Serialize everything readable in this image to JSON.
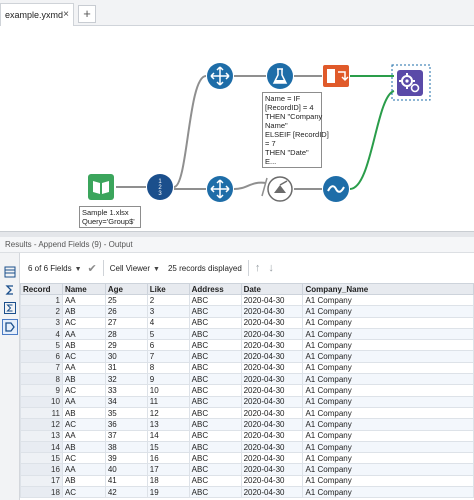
{
  "tabs": [
    {
      "label": "example.yxmd",
      "close": "×"
    }
  ],
  "tab_add": "+",
  "annotations": {
    "input": [
      "Sample 1.xlsx",
      "Query='Group$'"
    ],
    "formula": [
      "Name = IF",
      "[RecordID] = 4",
      "THEN \"Company",
      "Name\"",
      "ELSEIF [RecordID]",
      "= 7",
      "THEN \"Date\"",
      "E..."
    ]
  },
  "results_title": "Results - Append Fields (9) - Output",
  "toolbar": {
    "fields_label": "6 of 6 Fields",
    "viewer_label": "Cell Viewer",
    "records_label": "25 records displayed"
  },
  "colors": {
    "accent": "#1b4f8c",
    "connector": "#2a9d4a",
    "tool_blue": "#1e6da8",
    "tool_purple": "#5a4aa8",
    "tool_orange": "#e05a2a"
  },
  "grid": {
    "columns": [
      "Record",
      "Name",
      "Age",
      "Like",
      "Address",
      "Date",
      "Company_Name"
    ],
    "rows": [
      [
        "1",
        "AA",
        "25",
        "2",
        "ABC",
        "2020-04-30",
        "A1 Company"
      ],
      [
        "2",
        "AB",
        "26",
        "3",
        "ABC",
        "2020-04-30",
        "A1 Company"
      ],
      [
        "3",
        "AC",
        "27",
        "4",
        "ABC",
        "2020-04-30",
        "A1 Company"
      ],
      [
        "4",
        "AA",
        "28",
        "5",
        "ABC",
        "2020-04-30",
        "A1 Company"
      ],
      [
        "5",
        "AB",
        "29",
        "6",
        "ABC",
        "2020-04-30",
        "A1 Company"
      ],
      [
        "6",
        "AC",
        "30",
        "7",
        "ABC",
        "2020-04-30",
        "A1 Company"
      ],
      [
        "7",
        "AA",
        "31",
        "8",
        "ABC",
        "2020-04-30",
        "A1 Company"
      ],
      [
        "8",
        "AB",
        "32",
        "9",
        "ABC",
        "2020-04-30",
        "A1 Company"
      ],
      [
        "9",
        "AC",
        "33",
        "10",
        "ABC",
        "2020-04-30",
        "A1 Company"
      ],
      [
        "10",
        "AA",
        "34",
        "11",
        "ABC",
        "2020-04-30",
        "A1 Company"
      ],
      [
        "11",
        "AB",
        "35",
        "12",
        "ABC",
        "2020-04-30",
        "A1 Company"
      ],
      [
        "12",
        "AC",
        "36",
        "13",
        "ABC",
        "2020-04-30",
        "A1 Company"
      ],
      [
        "13",
        "AA",
        "37",
        "14",
        "ABC",
        "2020-04-30",
        "A1 Company"
      ],
      [
        "14",
        "AB",
        "38",
        "15",
        "ABC",
        "2020-04-30",
        "A1 Company"
      ],
      [
        "15",
        "AC",
        "39",
        "16",
        "ABC",
        "2020-04-30",
        "A1 Company"
      ],
      [
        "16",
        "AA",
        "40",
        "17",
        "ABC",
        "2020-04-30",
        "A1 Company"
      ],
      [
        "17",
        "AB",
        "41",
        "18",
        "ABC",
        "2020-04-30",
        "A1 Company"
      ],
      [
        "18",
        "AC",
        "42",
        "19",
        "ABC",
        "2020-04-30",
        "A1 Company"
      ]
    ]
  }
}
